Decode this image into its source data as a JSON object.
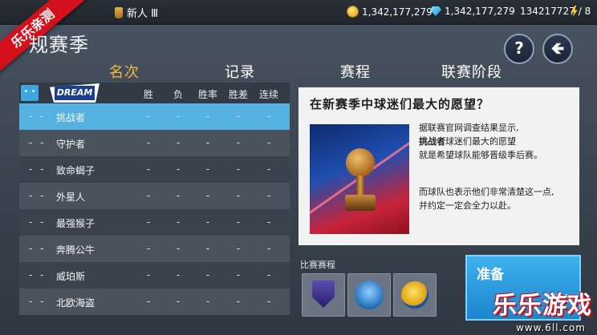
{
  "topbar": {
    "rank": "新人 Ⅲ",
    "coins": "1,342,177,279",
    "gems": "1,342,177,279",
    "energy": "134217727",
    "energy_suffix": "/ 8"
  },
  "watermark_ribbon": "乐乐亲测",
  "page_title": "规赛季",
  "buttons": {
    "help": "?",
    "back": "🡸"
  },
  "tabs": [
    "名次",
    "记录",
    "赛程",
    "联赛阶段"
  ],
  "table": {
    "team_logo": "DREAM",
    "headers": [
      "胜",
      "负",
      "胜率",
      "胜差",
      "连续"
    ],
    "rows": [
      {
        "rank": "- -",
        "name": "挑战者",
        "cells": [
          "-",
          "-",
          "-",
          "-",
          "-"
        ]
      },
      {
        "rank": "- -",
        "name": "守护者",
        "cells": [
          "-",
          "-",
          "-",
          "-",
          "-"
        ]
      },
      {
        "rank": "- -",
        "name": "致命蝎子",
        "cells": [
          "-",
          "-",
          "-",
          "-",
          "-"
        ]
      },
      {
        "rank": "- -",
        "name": "外星人",
        "cells": [
          "-",
          "-",
          "-",
          "-",
          "-"
        ]
      },
      {
        "rank": "- -",
        "name": "最强猴子",
        "cells": [
          "-",
          "-",
          "-",
          "-",
          "-"
        ]
      },
      {
        "rank": "- -",
        "name": "奔腾公牛",
        "cells": [
          "-",
          "-",
          "-",
          "-",
          "-"
        ]
      },
      {
        "rank": "- -",
        "name": "威珀斯",
        "cells": [
          "-",
          "-",
          "-",
          "-",
          "-"
        ]
      },
      {
        "rank": "- -",
        "name": "北欧海盗",
        "cells": [
          "-",
          "-",
          "-",
          "-",
          "-"
        ]
      }
    ]
  },
  "news": {
    "title": "在新赛季中球迷们最大的愿望？",
    "p1_line1": "据联赛官网调查结果显示,",
    "p1_bold": "挑战者",
    "p1_line2_rest": "球迷们最大的愿望",
    "p1_line3": "就是希望球队能够晋级季后赛。",
    "p2_line1": "而球队也表示他们非常清楚这一点,",
    "p2_line2": "并约定一定会全力以赴。"
  },
  "schedule_label": "比赛赛程",
  "ready": {
    "label": "准备",
    "sub": "比赛"
  },
  "watermark": {
    "text": "乐乐游戏",
    "url": "www.6ll.com"
  },
  "colors": {
    "selected_row": "#55b2e0",
    "active_tab": "#f0b93a",
    "ready_bg": "#1b86cf"
  }
}
